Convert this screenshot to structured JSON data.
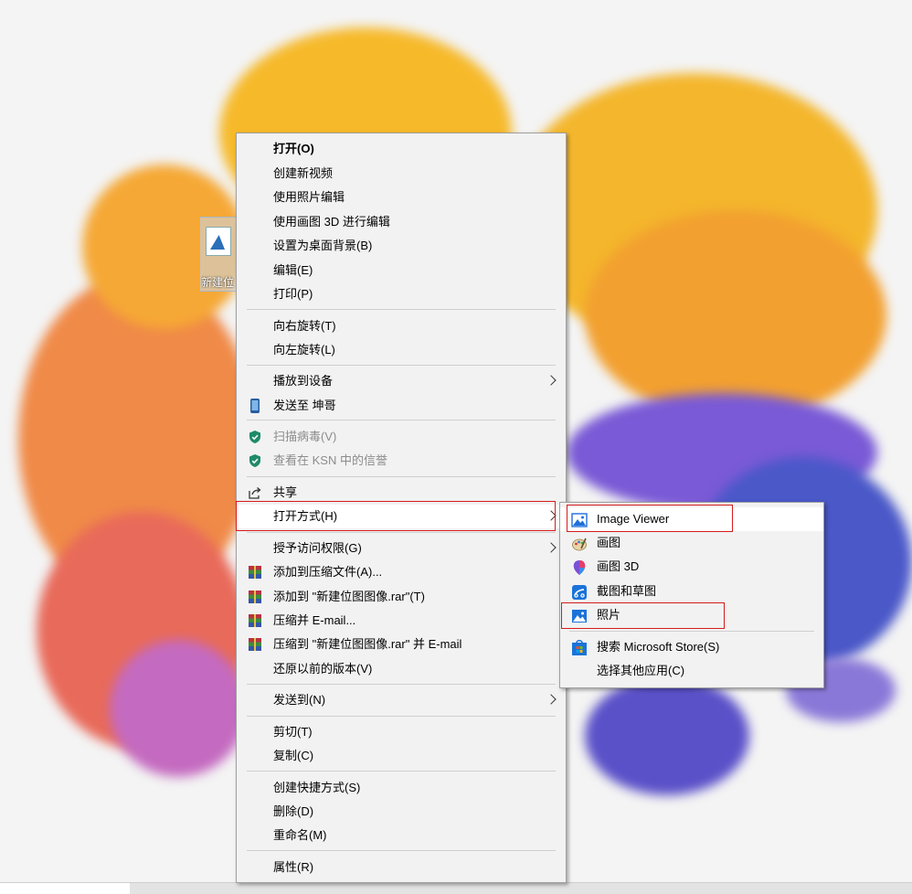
{
  "desktop": {
    "icon_label": "新建位"
  },
  "context_menu": {
    "items": [
      {
        "label": "打开(O)"
      },
      {
        "label": "创建新视频"
      },
      {
        "label": "使用照片编辑"
      },
      {
        "label": "使用画图 3D 进行编辑"
      },
      {
        "label": "设置为桌面背景(B)"
      },
      {
        "label": "编辑(E)"
      },
      {
        "label": "打印(P)"
      },
      {
        "label": "向右旋转(T)"
      },
      {
        "label": "向左旋转(L)"
      },
      {
        "label": "播放到设备"
      },
      {
        "label": "发送至 坤哥"
      },
      {
        "label": "扫描病毒(V)"
      },
      {
        "label": "查看在 KSN 中的信誉"
      },
      {
        "label": "共享"
      },
      {
        "label": "打开方式(H)"
      },
      {
        "label": "授予访问权限(G)"
      },
      {
        "label": "添加到压缩文件(A)..."
      },
      {
        "label": "添加到 \"新建位图图像.rar\"(T)"
      },
      {
        "label": "压缩并 E-mail..."
      },
      {
        "label": "压缩到 \"新建位图图像.rar\" 并 E-mail"
      },
      {
        "label": "还原以前的版本(V)"
      },
      {
        "label": "发送到(N)"
      },
      {
        "label": "剪切(T)"
      },
      {
        "label": "复制(C)"
      },
      {
        "label": "创建快捷方式(S)"
      },
      {
        "label": "删除(D)"
      },
      {
        "label": "重命名(M)"
      },
      {
        "label": "属性(R)"
      }
    ]
  },
  "open_with_submenu": {
    "items": [
      {
        "label": "Image Viewer",
        "icon": "image-viewer-icon"
      },
      {
        "label": "画图",
        "icon": "paint-icon"
      },
      {
        "label": "画图 3D",
        "icon": "paint-3d-icon"
      },
      {
        "label": "截图和草图",
        "icon": "snip-sketch-icon"
      },
      {
        "label": "照片",
        "icon": "photos-icon"
      },
      {
        "label": "搜索 Microsoft Store(S)",
        "icon": "store-icon"
      },
      {
        "label": "选择其他应用(C)"
      }
    ]
  },
  "colors": {
    "menu_bg": "#f2f2f2",
    "highlight_red": "#d41b1b",
    "shield_green": "#1f8a6a"
  }
}
